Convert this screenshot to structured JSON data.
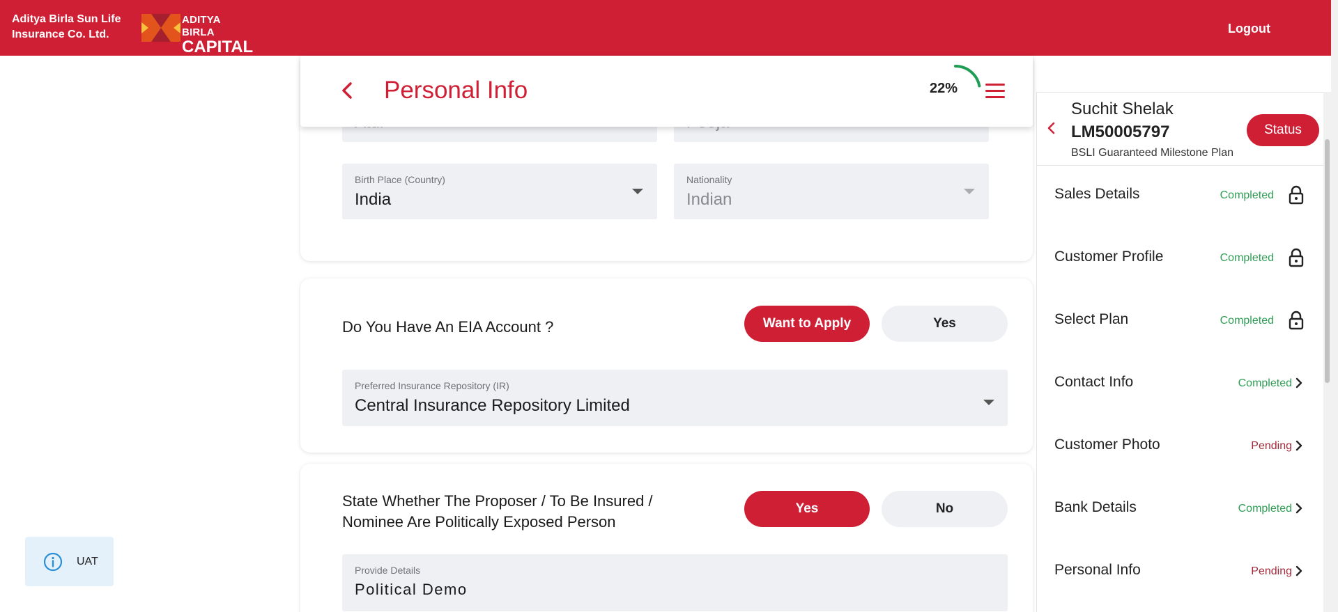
{
  "header": {
    "company_line1": "Aditya Birla Sun Life",
    "company_line2": "Insurance Co. Ltd.",
    "logo_line1": "ADITYA BIRLA",
    "logo_line2": "CAPITAL",
    "logout": "Logout"
  },
  "form": {
    "title": "Personal Info",
    "progress_text": "22%",
    "progress_fraction": 0.22,
    "partial_field_1": "Atul",
    "partial_field_2": "Pooja",
    "birth_place": {
      "label": "Birth Place (Country)",
      "value": "India"
    },
    "nationality": {
      "label": "Nationality",
      "value": "Indian"
    }
  },
  "eia": {
    "question": "Do You Have An EIA Account ?",
    "option_1": "Want to Apply",
    "option_2": "Yes",
    "repository": {
      "label": "Preferred Insurance Repository (IR)",
      "value": "Central Insurance Repository Limited"
    }
  },
  "pep": {
    "question_line1": "State Whether The Proposer / To Be Insured /",
    "question_line2": "Nominee Are Politically Exposed Person",
    "option_1": "Yes",
    "option_2": "No",
    "details": {
      "label": "Provide Details",
      "value": "Political Demo"
    }
  },
  "side": {
    "name": "Suchit Shelak",
    "id": "LM50005797",
    "plan": "BSLI Guaranteed Milestone Plan",
    "status_button": "Status",
    "steps": [
      {
        "name": "Sales Details",
        "status": "Completed",
        "state": "done",
        "icon": "lock-icon"
      },
      {
        "name": "Customer Profile",
        "status": "Completed",
        "state": "done",
        "icon": "lock-icon"
      },
      {
        "name": "Select Plan",
        "status": "Completed",
        "state": "done",
        "icon": "lock-icon"
      },
      {
        "name": "Contact Info",
        "status": "Completed",
        "state": "done",
        "icon": "chevron-right-icon"
      },
      {
        "name": "Customer Photo",
        "status": "Pending",
        "state": "pending",
        "icon": "chevron-right-icon"
      },
      {
        "name": "Bank Details",
        "status": "Completed",
        "state": "done",
        "icon": "chevron-right-icon"
      },
      {
        "name": "Personal Info",
        "status": "Pending",
        "state": "pending",
        "icon": "chevron-right-icon"
      }
    ]
  },
  "badge": {
    "text": "UAT"
  },
  "colors": {
    "brand_red": "#cf1f35",
    "completed_green": "#2f9e55",
    "pending_red": "#a3293a",
    "progress_green": "#1f9d55"
  }
}
